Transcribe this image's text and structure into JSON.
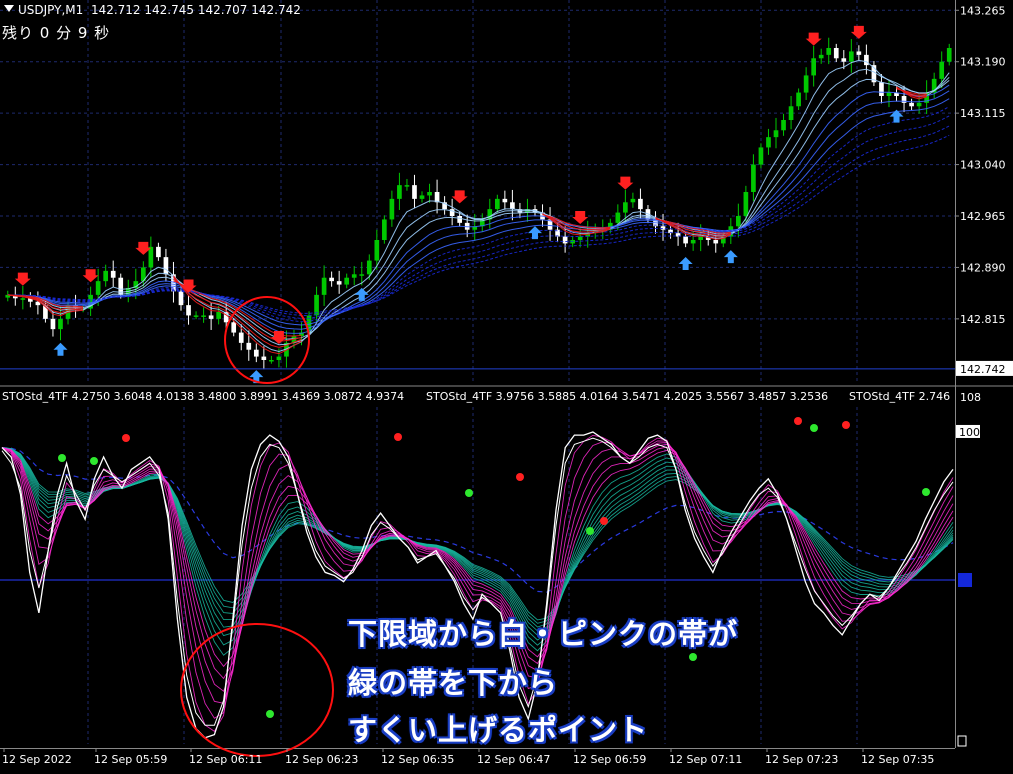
{
  "header": {
    "symbol": "USDJPY,M1",
    "ohlc": "142.712 142.745 142.707 142.742"
  },
  "timer": "残り 0 分 9 秒",
  "indicator_labels": [
    "STOStd_4TF 4.2750 3.6048 4.0138 3.4800 3.8991 3.4369 3.0872 4.9374",
    "STOStd_4TF 3.9756 3.5885 4.0164 3.5471 4.2025 3.5567 3.4857 3.2536",
    "STOStd_4TF 2.746"
  ],
  "annotation_lines": [
    "下限域から白・ピンクの帯が",
    "緑の帯を下から",
    "すくい上げるポイント"
  ],
  "colors": {
    "background": "#000000",
    "grid": "#1e2a6e",
    "bull_candle": "#00c800",
    "bear_candle": "#ffffff",
    "sell_arrow": "#ff2020",
    "buy_arrow": "#3a9bff",
    "sto_white": "#ffffff",
    "sto_pink": "#ff2ad4",
    "sto_green": "#18b8a0",
    "circle": "#ff1010",
    "annotation_outline": "#1b3fc4"
  },
  "chart_data": [
    {
      "type": "candlestick",
      "title": "USDJPY,M1",
      "ylim": [
        142.72,
        143.28
      ],
      "y_ticks": [
        "143.265",
        "143.190",
        "143.115",
        "143.040",
        "142.965",
        "142.890",
        "142.815"
      ],
      "current_price": "142.742",
      "x_ticks": [
        "12 Sep 2022",
        "12 Sep 05:59",
        "12 Sep 06:11",
        "12 Sep 06:23",
        "12 Sep 06:35",
        "12 Sep 06:47",
        "12 Sep 06:59",
        "12 Sep 07:11",
        "12 Sep 07:23",
        "12 Sep 07:35"
      ],
      "close": [
        142.85,
        142.845,
        142.845,
        142.84,
        142.835,
        142.815,
        142.8,
        142.815,
        142.835,
        142.83,
        142.83,
        142.85,
        142.87,
        142.885,
        142.875,
        142.85,
        142.86,
        142.87,
        142.89,
        142.92,
        142.905,
        142.88,
        142.855,
        142.835,
        142.82,
        142.82,
        142.82,
        142.815,
        142.825,
        142.81,
        142.795,
        142.78,
        142.77,
        142.76,
        142.755,
        142.755,
        142.76,
        142.78,
        142.79,
        142.795,
        142.82,
        142.85,
        142.875,
        142.87,
        142.865,
        142.875,
        142.88,
        142.88,
        142.9,
        142.93,
        142.96,
        142.99,
        143.01,
        143.01,
        142.99,
        142.995,
        143.0,
        142.985,
        142.975,
        142.965,
        142.955,
        142.945,
        142.95,
        142.96,
        142.975,
        142.99,
        142.985,
        142.975,
        142.97,
        142.975,
        142.97,
        142.96,
        142.945,
        142.935,
        142.925,
        142.93,
        142.935,
        142.94,
        142.945,
        142.945,
        142.955,
        142.97,
        142.985,
        142.99,
        142.975,
        142.96,
        142.95,
        142.945,
        142.94,
        142.935,
        142.925,
        142.93,
        142.935,
        142.93,
        142.925,
        142.935,
        142.95,
        142.965,
        143.0,
        143.04,
        143.065,
        143.08,
        143.09,
        143.105,
        143.125,
        143.145,
        143.17,
        143.195,
        143.2,
        143.21,
        143.195,
        143.19,
        143.205,
        143.2,
        143.185,
        143.16,
        143.14,
        143.145,
        143.14,
        143.13,
        143.125,
        143.13,
        143.145,
        143.165,
        143.19,
        143.21
      ]
    },
    {
      "type": "line",
      "title": "STOStd_4TF",
      "ylim": [
        0,
        108
      ],
      "y_ticks": [
        "108",
        "100"
      ],
      "series": [
        {
          "values": [
            95,
            92,
            80,
            55,
            42,
            62,
            80,
            90,
            78,
            72,
            85,
            92,
            86,
            82,
            88,
            90,
            92,
            88,
            72,
            40,
            15,
            5,
            2,
            3,
            12,
            40,
            70,
            88,
            96,
            99,
            97,
            92,
            80,
            68,
            60,
            55,
            54,
            52,
            56,
            62,
            70,
            74,
            70,
            66,
            63,
            58,
            60,
            62,
            57,
            52,
            45,
            40,
            48,
            45,
            42,
            30,
            15,
            8,
            20,
            45,
            75,
            95,
            99,
            99,
            100,
            98,
            96,
            92,
            90,
            94,
            98,
            99,
            97,
            88,
            75,
            66,
            60,
            55,
            62,
            68,
            73,
            78,
            82,
            85,
            80,
            72,
            62,
            52,
            45,
            42,
            38,
            35,
            40,
            45,
            48,
            46,
            50,
            55,
            60,
            65,
            72,
            78,
            84,
            88
          ]
        },
        {
          "values": [
            94,
            90,
            82,
            62,
            50,
            62,
            76,
            86,
            80,
            75,
            83,
            88,
            86,
            84,
            86,
            88,
            90,
            86,
            74,
            46,
            22,
            10,
            6,
            6,
            14,
            38,
            64,
            82,
            92,
            96,
            95,
            90,
            80,
            70,
            62,
            57,
            55,
            53,
            55,
            60,
            67,
            71,
            69,
            66,
            63,
            59,
            60,
            61,
            57,
            53,
            47,
            43,
            47,
            45,
            42,
            32,
            19,
            12,
            22,
            43,
            70,
            90,
            96,
            97,
            98,
            97,
            95,
            92,
            90,
            92,
            95,
            96,
            95,
            88,
            77,
            68,
            62,
            57,
            61,
            66,
            71,
            76,
            80,
            82,
            79,
            72,
            64,
            56,
            49,
            45,
            41,
            38,
            41,
            45,
            48,
            47,
            50,
            54,
            58,
            63,
            69,
            75,
            80,
            84
          ]
        }
      ]
    }
  ]
}
